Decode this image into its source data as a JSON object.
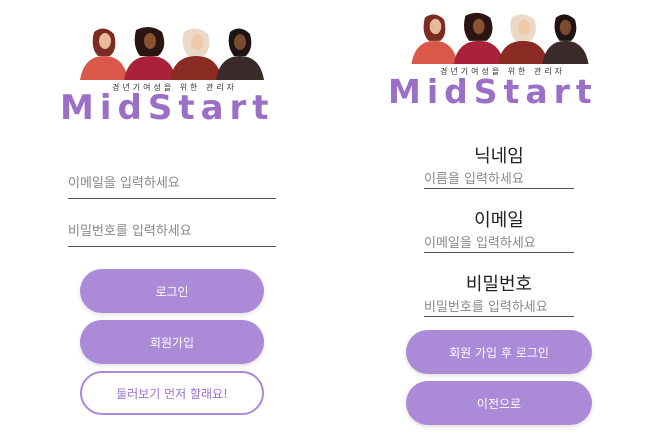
{
  "colors": {
    "accent": "#ab8ad8",
    "brand": "#9b6fc6"
  },
  "login": {
    "tagline": "경년기여성을 위한 관리자",
    "brand": "MidStart",
    "email_placeholder": "이메일을 입력하세요",
    "password_placeholder": "비밀번호를 입력하세요",
    "login_label": "로그인",
    "signup_label": "회원가입",
    "browse_label": "둘러보기 먼저 할래요!"
  },
  "signup": {
    "tagline": "경년기여성을 위한 관리자",
    "brand": "MidStart",
    "nickname_label": "닉네임",
    "nickname_placeholder": "이름을 입력하세요",
    "email_label": "이메일",
    "email_placeholder": "이메일을 입력하세요",
    "password_label": "비밀번호",
    "password_placeholder": "비밀번호를 입력하세요",
    "submit_label": "회원 가입 후 로그인",
    "back_label": "이전으로"
  }
}
